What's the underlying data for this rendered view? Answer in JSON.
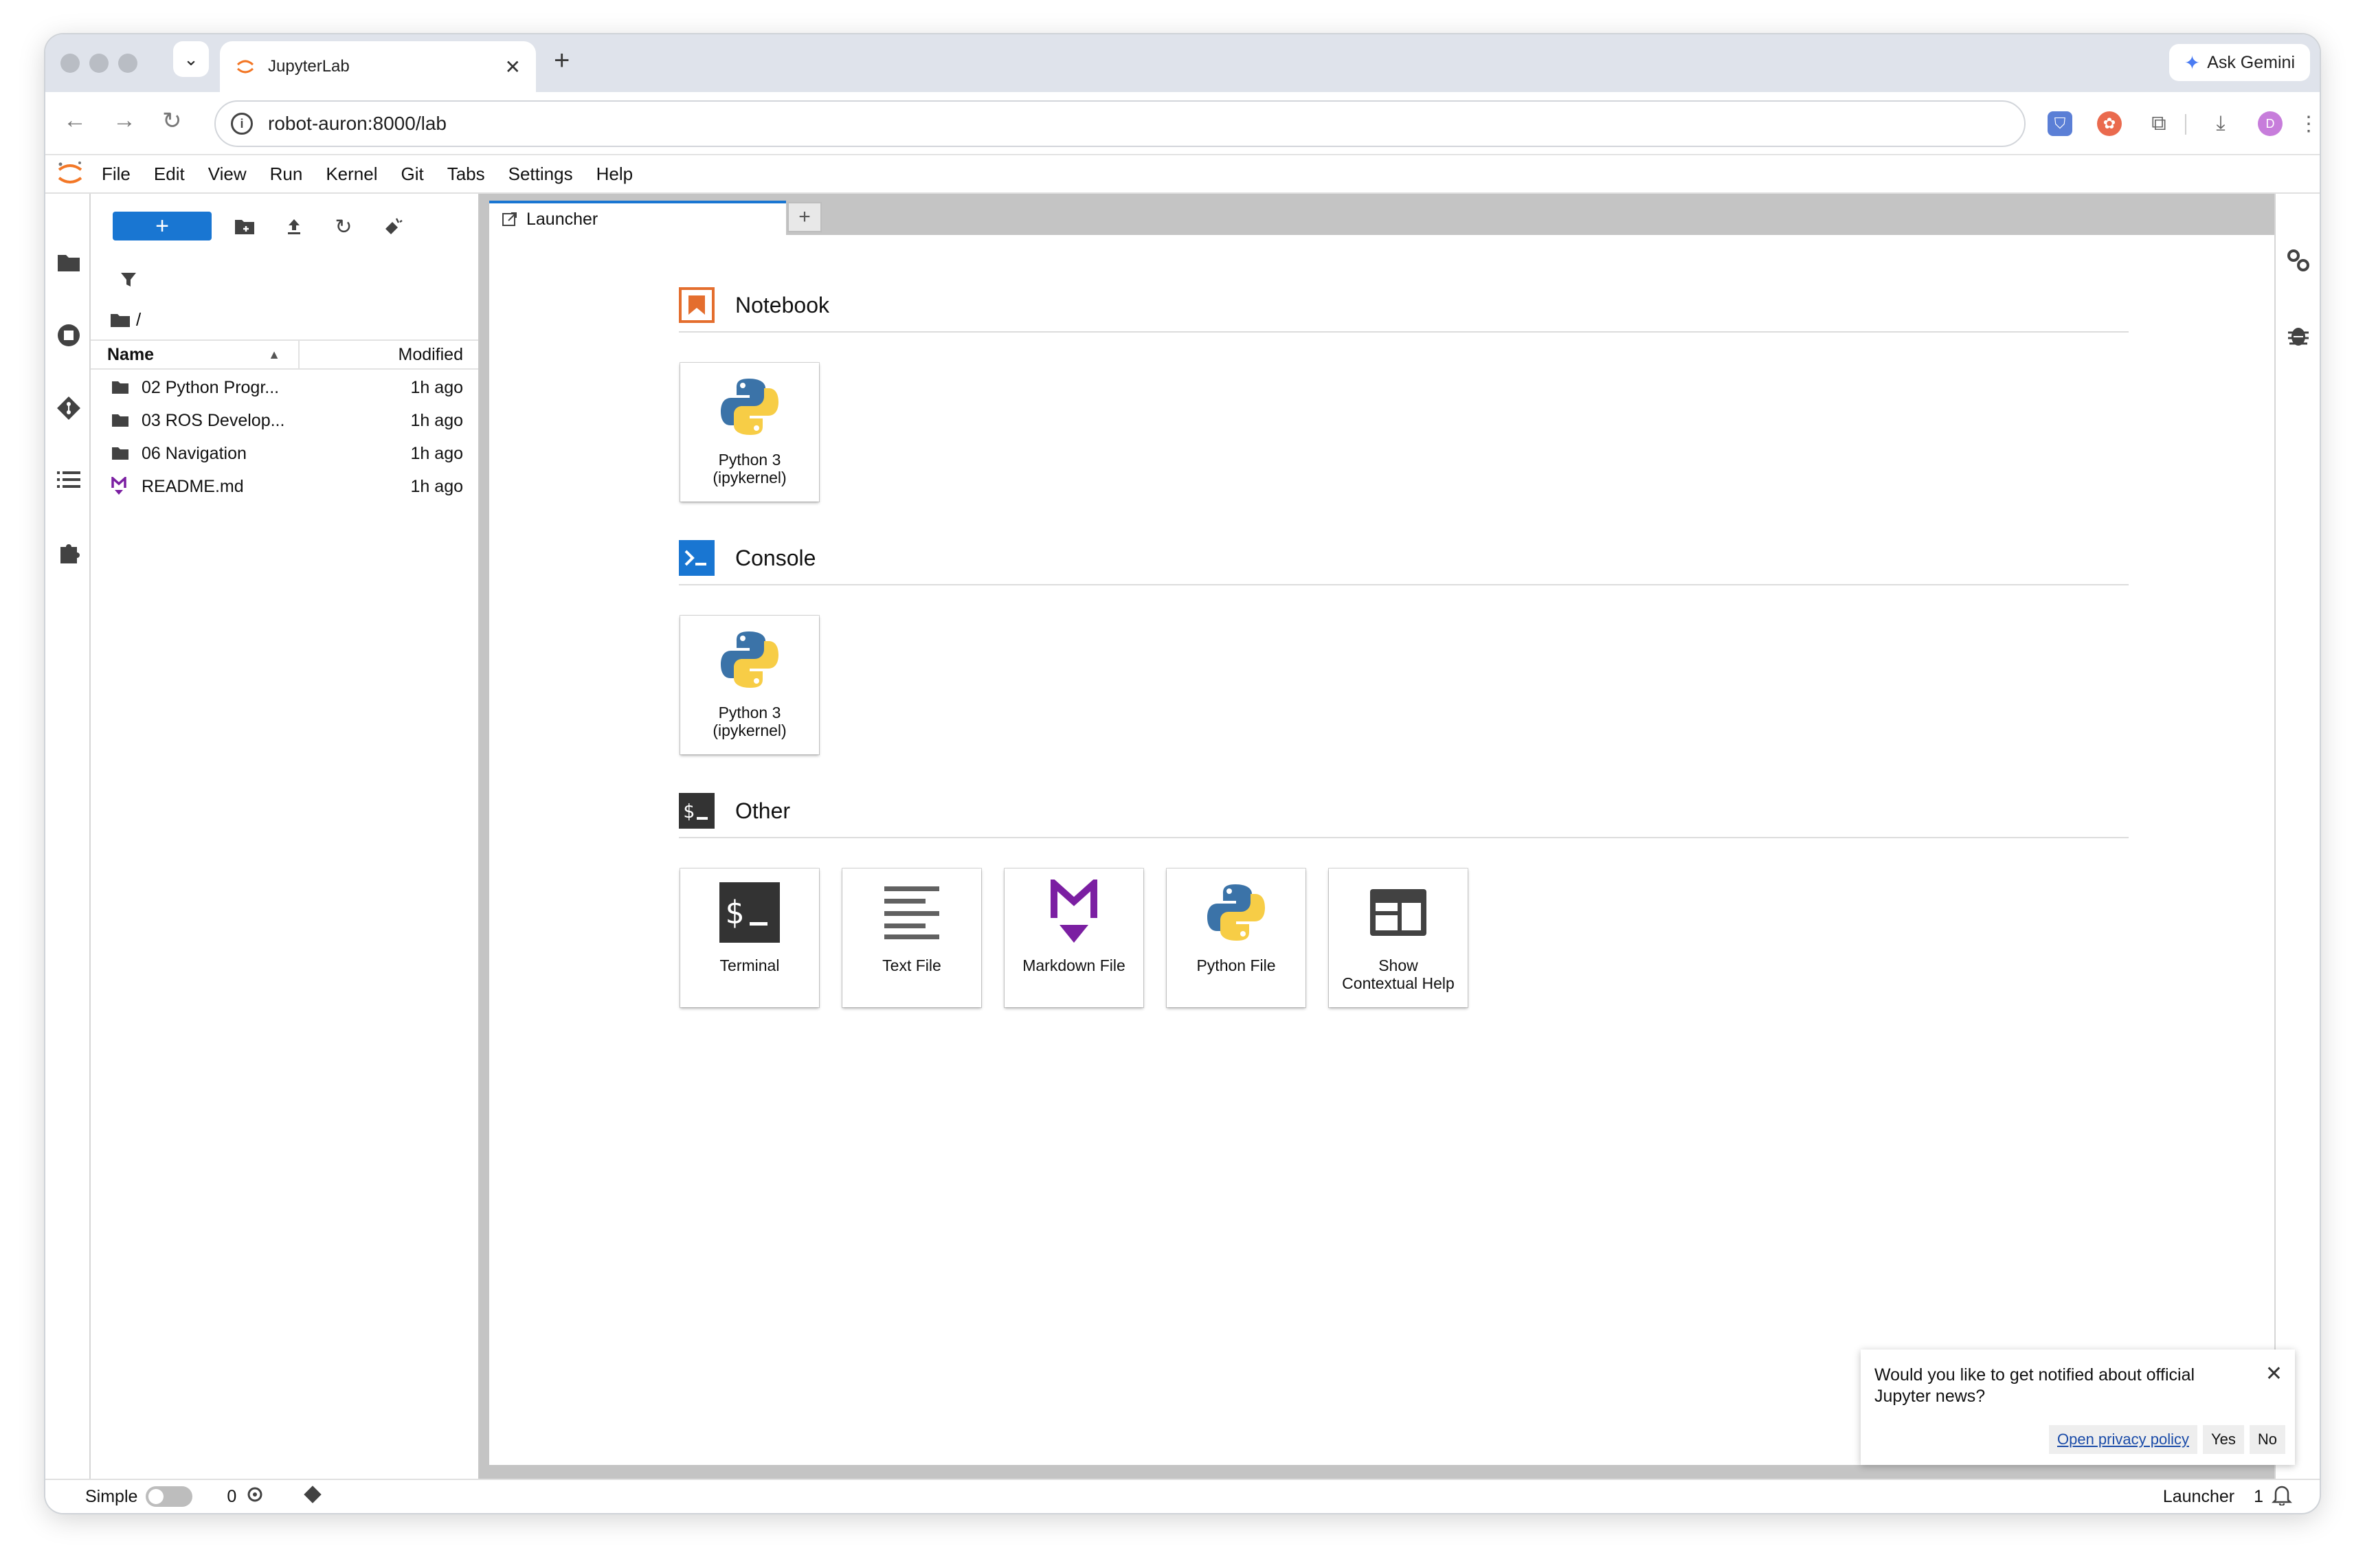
{
  "browser": {
    "tab_title": "JupyterLab",
    "url": "robot-auron:8000/lab",
    "ask_gemini": "Ask Gemini",
    "profile_initial": "D"
  },
  "menubar": {
    "items": [
      "File",
      "Edit",
      "View",
      "Run",
      "Kernel",
      "Git",
      "Tabs",
      "Settings",
      "Help"
    ]
  },
  "file_browser": {
    "new_button": "+",
    "path": "/",
    "columns": {
      "name": "Name",
      "modified": "Modified"
    },
    "rows": [
      {
        "name": "02 Python Progr...",
        "modified": "1h ago",
        "type": "folder"
      },
      {
        "name": "03 ROS Develop...",
        "modified": "1h ago",
        "type": "folder"
      },
      {
        "name": "06 Navigation",
        "modified": "1h ago",
        "type": "folder"
      },
      {
        "name": "README.md",
        "modified": "1h ago",
        "type": "markdown"
      }
    ]
  },
  "main_tab": {
    "label": "Launcher",
    "add": "+"
  },
  "launcher": {
    "notebook": {
      "title": "Notebook",
      "cards": [
        {
          "label": "Python 3\n(ipykernel)"
        }
      ]
    },
    "console": {
      "title": "Console",
      "cards": [
        {
          "label": "Python 3\n(ipykernel)"
        }
      ]
    },
    "other": {
      "title": "Other",
      "cards": [
        {
          "label": "Terminal"
        },
        {
          "label": "Text File"
        },
        {
          "label": "Markdown File"
        },
        {
          "label": "Python File"
        },
        {
          "label": "Show\nContextual Help"
        }
      ]
    }
  },
  "statusbar": {
    "simple": "Simple",
    "kernels": "0",
    "mode": "Launcher",
    "notifications": "1"
  },
  "toast": {
    "message": "Would you like to get notified about official Jupyter news?",
    "privacy": "Open privacy policy",
    "yes": "Yes",
    "no": "No"
  },
  "colors": {
    "accent": "#1976d2",
    "notebook_orange": "#e46e2e",
    "console_blue": "#1976d2",
    "markdown_purple": "#7b1fa2"
  }
}
